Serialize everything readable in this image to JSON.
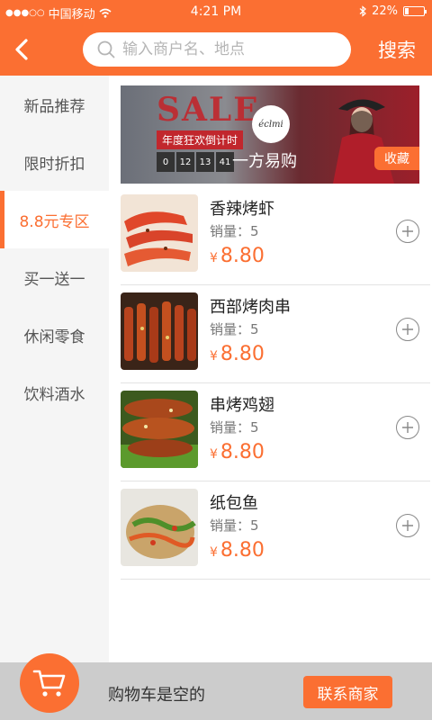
{
  "status_bar": {
    "carrier": "中国移动",
    "time": "4:21 PM",
    "battery": "22%",
    "battery_level": 0.22
  },
  "header": {
    "search_placeholder": "输入商户名、地点",
    "search_label": "搜索"
  },
  "sidebar": {
    "items": [
      {
        "label": "新品推荐"
      },
      {
        "label": "限时折扣"
      },
      {
        "label": "8.8元专区"
      },
      {
        "label": "买一送一"
      },
      {
        "label": "休闲零食"
      },
      {
        "label": "饮料酒水"
      }
    ],
    "active_index": 2
  },
  "banner": {
    "sale_word": "SALE",
    "sale_subtitle": "年度狂欢倒计时",
    "countdown": [
      "0",
      "12",
      "13",
      "41"
    ],
    "logo_text": "éclmi",
    "shop_name": "一方易购",
    "favorite_label": "收藏"
  },
  "products": [
    {
      "name": "香辣烤虾",
      "sales": "销量：5",
      "currency": "¥",
      "price": "8.80"
    },
    {
      "name": "西部烤肉串",
      "sales": "销量：5",
      "currency": "¥",
      "price": "8.80"
    },
    {
      "name": "串烤鸡翅",
      "sales": "销量：5",
      "currency": "¥",
      "price": "8.80"
    },
    {
      "name": "纸包鱼",
      "sales": "销量：5",
      "currency": "¥",
      "price": "8.80"
    }
  ],
  "cart": {
    "empty_text": "购物车是空的",
    "contact_label": "联系商家"
  },
  "colors": {
    "accent": "#fb6f32",
    "sidebar_bg": "#f5f5f5",
    "cartbar_bg": "#cccccc"
  }
}
